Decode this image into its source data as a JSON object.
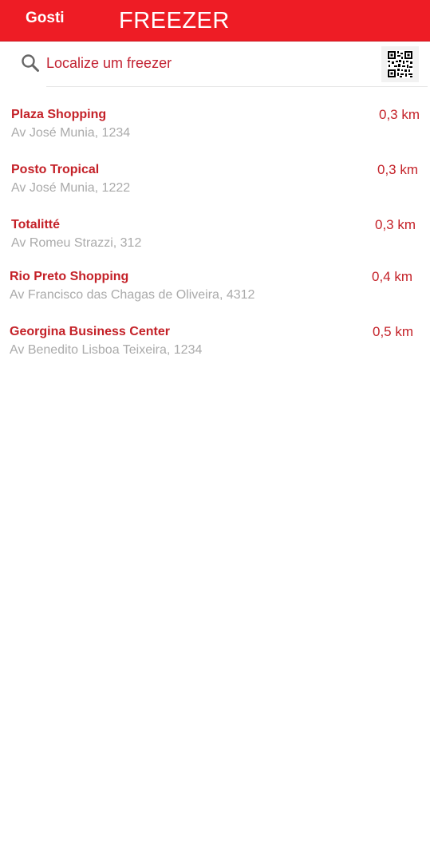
{
  "header": {
    "brand": "Gosti",
    "title": "FREEZER",
    "background_color": "#ee1c25"
  },
  "search": {
    "placeholder": "Localize um freezer",
    "icon": "search-icon",
    "qr_icon": "qr-code-icon"
  },
  "colors": {
    "accent": "#c42128",
    "secondary_text": "#aaaaaa"
  },
  "locations": [
    {
      "name": "Plaza Shopping",
      "address": "Av José Munia, 1234",
      "distance": "0,3 km"
    },
    {
      "name": "Posto Tropical",
      "address": "Av José Munia, 1222",
      "distance": "0,3 km"
    },
    {
      "name": "Totalitté",
      "address": "Av Romeu Strazzi, 312",
      "distance": "0,3 km"
    },
    {
      "name": "Rio Preto Shopping",
      "address": "Av Francisco das Chagas de Oliveira, 4312",
      "distance": "0,4 km"
    },
    {
      "name": "Georgina Business Center",
      "address": "Av Benedito Lisboa Teixeira, 1234",
      "distance": "0,5 km"
    }
  ]
}
